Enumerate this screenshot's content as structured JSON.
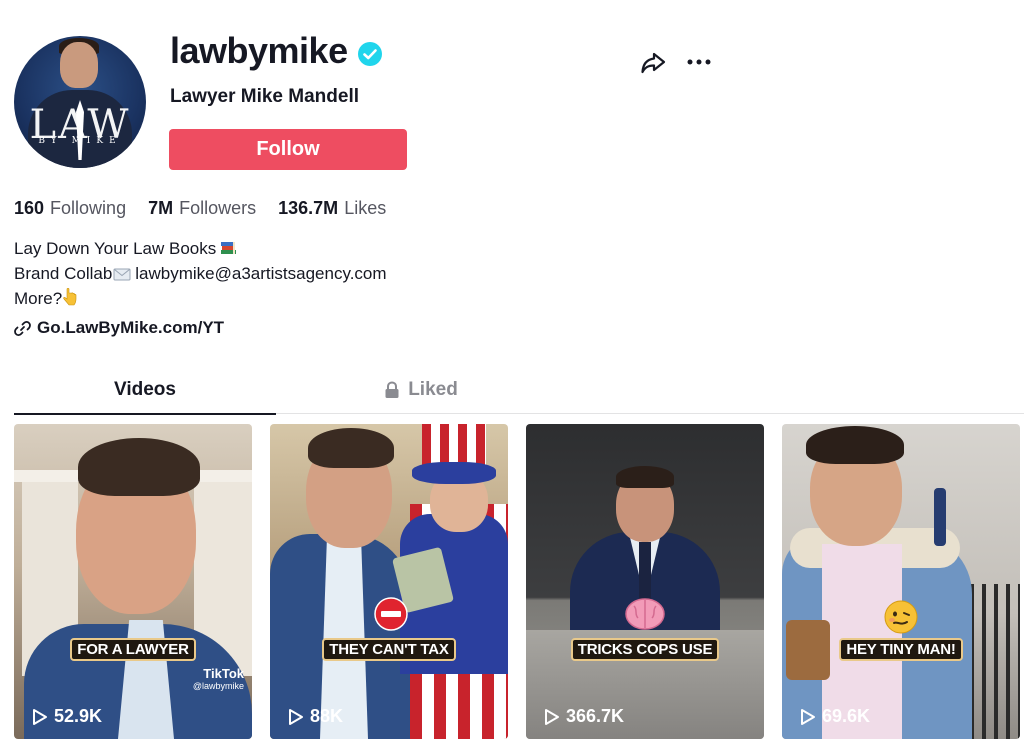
{
  "profile": {
    "username": "lawbymike",
    "display_name": "Lawyer Mike Mandell",
    "verified": true,
    "follow_label": "Follow",
    "avatar_logo_main": "LAW",
    "avatar_logo_sub": "BY MIKE"
  },
  "actions": {
    "share_icon": "share-arrow-icon",
    "more_icon": "more-dots-icon"
  },
  "stats": [
    {
      "number": "160",
      "label": "Following"
    },
    {
      "number": "7M",
      "label": "Followers"
    },
    {
      "number": "136.7M",
      "label": "Likes"
    }
  ],
  "bio": {
    "line1": "Lay Down Your Law Books",
    "line1_emoji": "books-emoji",
    "line2_prefix": "Brand Collab",
    "line2_emoji": "envelope-emoji",
    "line2_email": "lawbymike@a3artistsagency.com",
    "line3": "More?",
    "line3_emoji": "pointing-down-emoji",
    "link": "Go.LawByMike.com/YT"
  },
  "tabs": [
    {
      "label": "Videos",
      "active": true
    },
    {
      "label": "Liked",
      "active": false,
      "locked": true
    }
  ],
  "videos": [
    {
      "caption": "FOR A LAWYER",
      "views": "52.9K",
      "watermark_brand": "TikTok",
      "watermark_user": "@lawbymike"
    },
    {
      "caption": "THEY CAN'T TAX",
      "views": "88K",
      "overlay_emoji": "no-entry-emoji"
    },
    {
      "caption": "TRICKS COPS USE",
      "views": "366.7K",
      "overlay_emoji": "brain-emoji"
    },
    {
      "caption": "HEY TINY MAN!",
      "views": "69.6K",
      "overlay_emoji": "woozy-face-emoji"
    }
  ],
  "colors": {
    "follow_button": "#ee4d61",
    "verified_badge": "#20d5ec",
    "caption_border": "#e9c98a",
    "primary_text": "#161823",
    "secondary_text": "#555660"
  }
}
